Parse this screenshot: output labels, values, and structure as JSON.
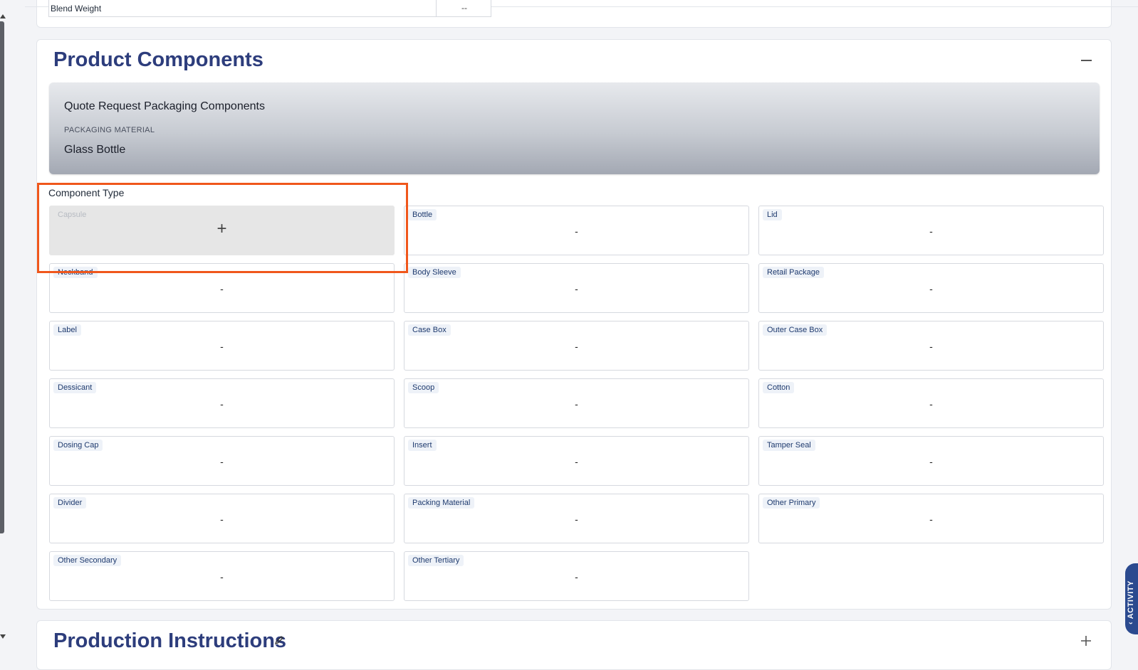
{
  "blend": {
    "label": "Blend Weight",
    "value": "--"
  },
  "product_components": {
    "title": "Product Components",
    "panel": {
      "title": "Quote Request Packaging Components",
      "material_label": "PACKAGING MATERIAL",
      "material_value": "Glass Bottle"
    },
    "component_type_label": "Component Type",
    "components": [
      {
        "label": "Capsule",
        "value": "+"
      },
      {
        "label": "Bottle",
        "value": "-"
      },
      {
        "label": "Lid",
        "value": "-"
      },
      {
        "label": "Neckband",
        "value": "-"
      },
      {
        "label": "Body Sleeve",
        "value": "-"
      },
      {
        "label": "Retail Package",
        "value": "-"
      },
      {
        "label": "Label",
        "value": "-"
      },
      {
        "label": "Case Box",
        "value": "-"
      },
      {
        "label": "Outer Case Box",
        "value": "-"
      },
      {
        "label": "Dessicant",
        "value": "-"
      },
      {
        "label": "Scoop",
        "value": "-"
      },
      {
        "label": "Cotton",
        "value": "-"
      },
      {
        "label": "Dosing Cap",
        "value": "-"
      },
      {
        "label": "Insert",
        "value": "-"
      },
      {
        "label": "Tamper Seal",
        "value": "-"
      },
      {
        "label": "Divider",
        "value": "-"
      },
      {
        "label": "Packing Material",
        "value": "-"
      },
      {
        "label": "Other Primary",
        "value": "-"
      },
      {
        "label": "Other Secondary",
        "value": "-"
      },
      {
        "label": "Other Tertiary",
        "value": "-"
      }
    ]
  },
  "production_instructions": {
    "title": "Production Instructions"
  },
  "activity": {
    "label": "ACTIVITY"
  },
  "colors": {
    "accent": "#2d3d7c",
    "highlight": "#f0571c",
    "activity_tab": "#2b4a8f"
  },
  "icons": [
    "collapse-icon",
    "plus-icon",
    "pencil-icon",
    "chevron-up-icon"
  ]
}
